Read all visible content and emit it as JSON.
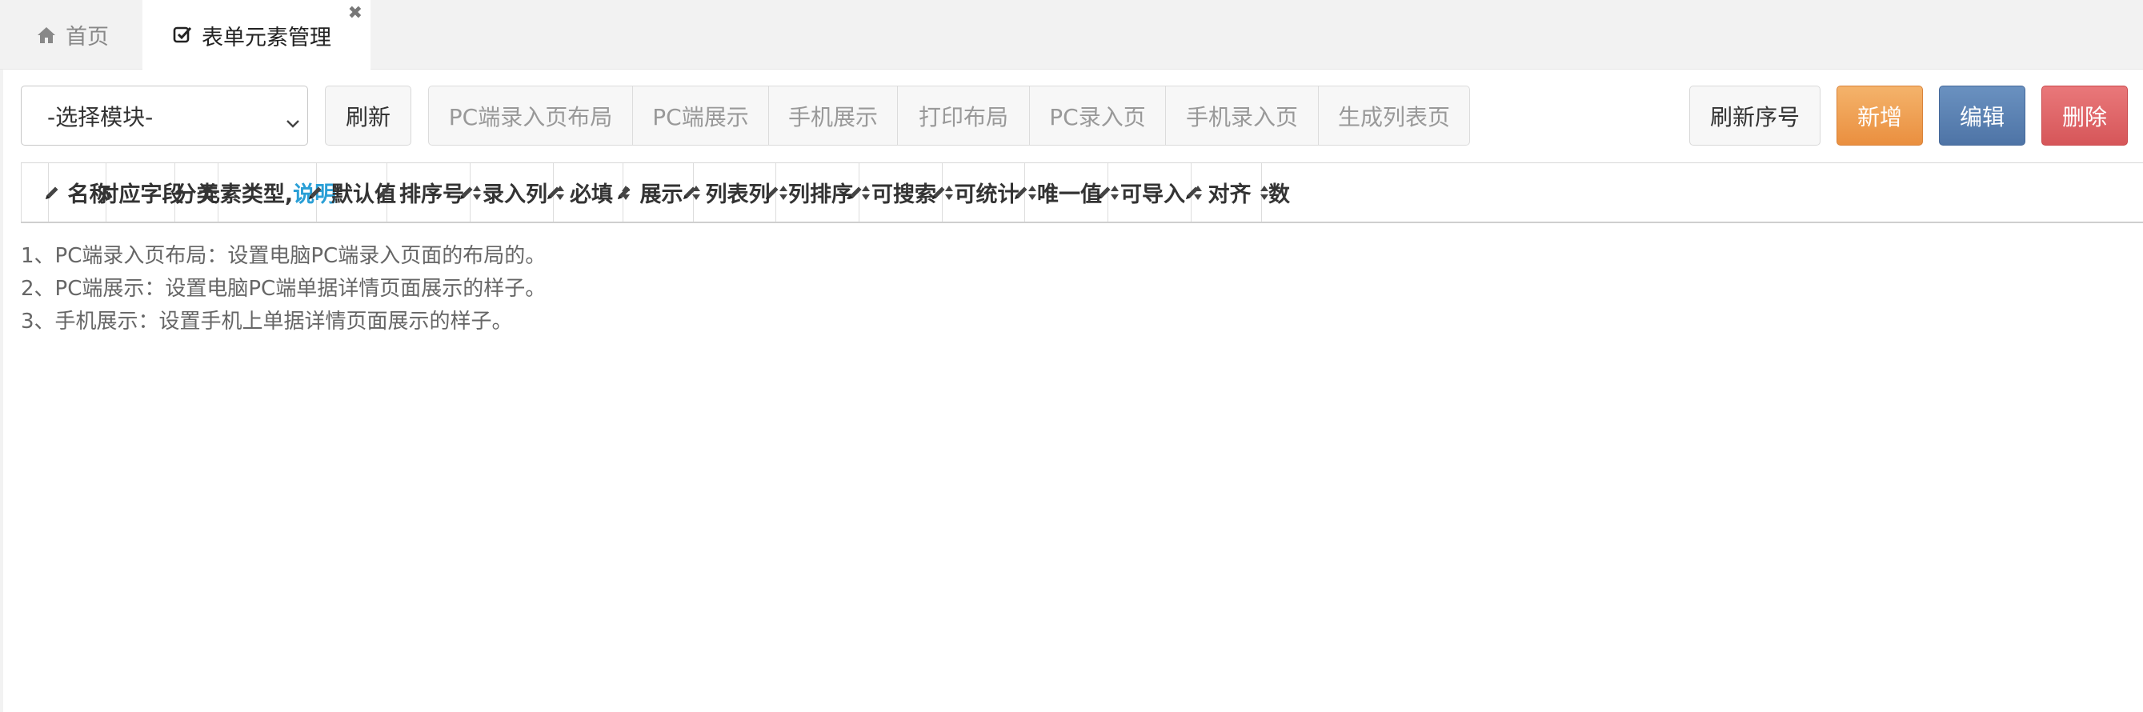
{
  "tabs": {
    "home": {
      "label": "首页",
      "icon": "home-icon"
    },
    "active": {
      "label": "表单元素管理",
      "icon": "checkbox-icon",
      "close": "✖"
    }
  },
  "toolbar": {
    "module_select_value": "-选择模块-",
    "refresh_label": "刷新",
    "group_buttons": [
      "PC端录入页布局",
      "PC端展示",
      "手机展示",
      "打印布局",
      "PC录入页",
      "手机录入页",
      "生成列表页"
    ],
    "refresh_seq_label": "刷新序号",
    "add_label": "新增",
    "edit_label": "编辑",
    "delete_label": "删除"
  },
  "colors": {
    "add": "#ea8f3f",
    "edit": "#4e74a6",
    "delete": "#d65659",
    "link": "#2a9fd6"
  },
  "table": {
    "columns": [
      {
        "label": "",
        "pen": false,
        "sort": false
      },
      {
        "label": "名称",
        "pen": true,
        "sort": false
      },
      {
        "label": "对应字段",
        "pen": false,
        "sort": false
      },
      {
        "label": "分类",
        "pen": false,
        "sort": false
      },
      {
        "label": "元素类型,",
        "link": "说明",
        "pen": false,
        "sort": false
      },
      {
        "label": "默认值",
        "pen": true,
        "sort": false
      },
      {
        "label": "排序号",
        "pen": true,
        "sort": true
      },
      {
        "label": "录入列",
        "pen": true,
        "sort": true
      },
      {
        "label": "必填",
        "pen": true,
        "sort": true
      },
      {
        "label": "展示",
        "pen": true,
        "sort": true
      },
      {
        "label": "列表列",
        "pen": true,
        "sort": true
      },
      {
        "label": "列排序",
        "pen": true,
        "sort": true
      },
      {
        "label": "可搜索",
        "pen": true,
        "sort": true
      },
      {
        "label": "可统计",
        "pen": true,
        "sort": true
      },
      {
        "label": "唯一值",
        "pen": true,
        "sort": true
      },
      {
        "label": "可导入",
        "pen": true,
        "sort": true
      },
      {
        "label": "对齐",
        "pen": true,
        "sort": true
      },
      {
        "label": "数",
        "pen": false,
        "sort": false
      }
    ]
  },
  "notes": [
    "1、PC端录入页布局：设置电脑PC端录入页面的布局的。",
    "2、PC端展示：设置电脑PC端单据详情页面展示的样子。",
    "3、手机展示：设置手机上单据详情页面展示的样子。"
  ]
}
